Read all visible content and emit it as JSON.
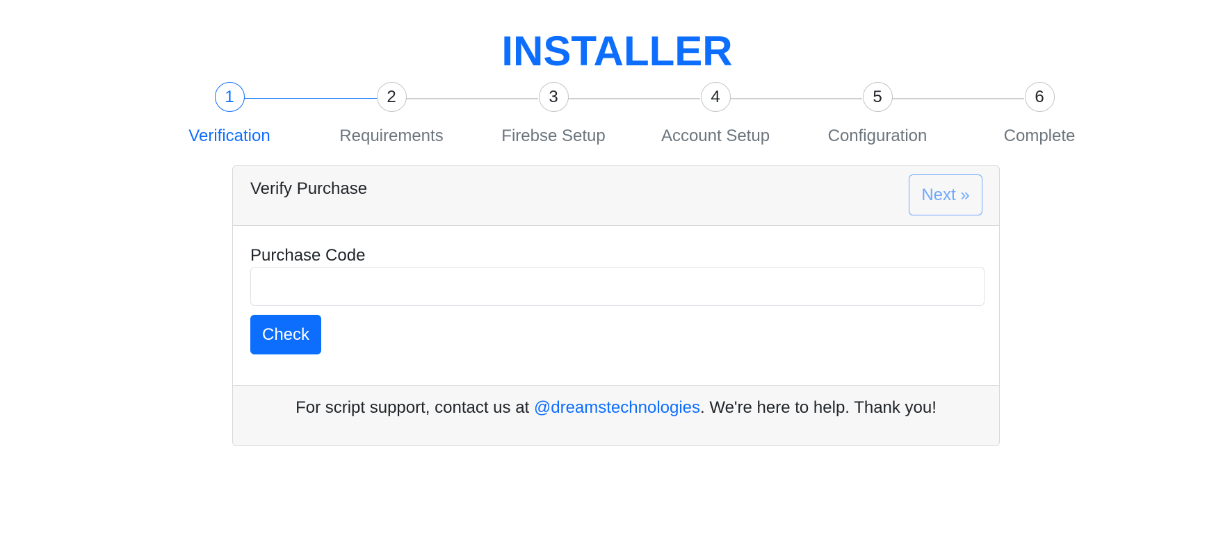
{
  "header": {
    "title": "INSTALLER"
  },
  "stepper": {
    "active_index": 0,
    "steps": [
      {
        "number": "1",
        "label": "Verification"
      },
      {
        "number": "2",
        "label": "Requirements"
      },
      {
        "number": "3",
        "label": "Firebse Setup"
      },
      {
        "number": "4",
        "label": "Account Setup"
      },
      {
        "number": "5",
        "label": "Configuration"
      },
      {
        "number": "6",
        "label": "Complete"
      }
    ]
  },
  "card": {
    "title": "Verify Purchase",
    "next_label": "Next »",
    "purchase_code_label": "Purchase Code",
    "purchase_code_value": "",
    "purchase_code_placeholder": "",
    "check_label": "Check"
  },
  "footer": {
    "text_before": "For script support, contact us at ",
    "link_text": "@dreamstechnologies",
    "text_after": ". We're here to help. Thank you!"
  },
  "colors": {
    "accent": "#0d6efd",
    "accent_light": "#6ea8fe",
    "muted_text": "#6c757d",
    "panel_bg": "#f7f7f7",
    "border": "#d9d9d9"
  }
}
